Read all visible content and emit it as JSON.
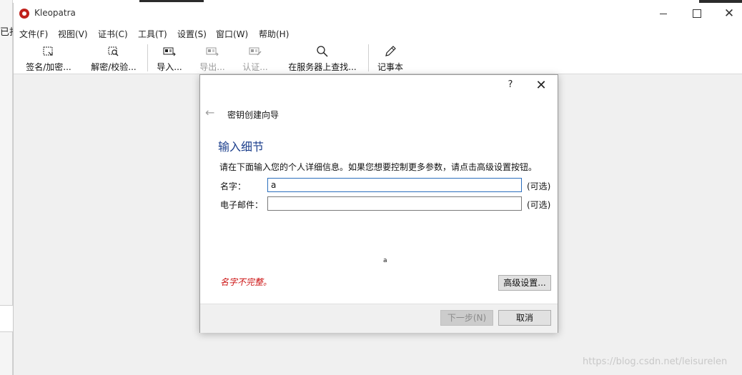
{
  "background": {
    "left_fragment": "已打"
  },
  "window": {
    "title": "Kleopatra",
    "minimize_glyph": "",
    "maximize_glyph": "",
    "close_glyph": "✕"
  },
  "menu": {
    "items": [
      "文件(F)",
      "视图(V)",
      "证书(C)",
      "工具(T)",
      "设置(S)",
      "窗口(W)",
      "帮助(H)"
    ]
  },
  "toolbar": {
    "items": [
      {
        "label": "签名/加密...",
        "icon": "sign-encrypt-icon",
        "enabled": true
      },
      {
        "label": "解密/校验...",
        "icon": "decrypt-verify-icon",
        "enabled": true
      },
      {
        "label": "导入...",
        "icon": "import-icon",
        "enabled": true
      },
      {
        "label": "导出...",
        "icon": "export-icon",
        "enabled": false
      },
      {
        "label": "认证...",
        "icon": "certify-icon",
        "enabled": false
      },
      {
        "label": "在服务器上查找...",
        "icon": "search-icon",
        "enabled": true
      },
      {
        "label": "记事本",
        "icon": "pencil-icon",
        "enabled": true
      }
    ]
  },
  "dialog": {
    "help_glyph": "?",
    "close_glyph": "✕",
    "back_glyph": "←",
    "wizard_title": "密钥创建向导",
    "heading": "输入细节",
    "description": "请在下面输入您的个人详细信息。如果您想要控制更多参数，请点击高级设置按钮。",
    "fields": [
      {
        "label": "名字：",
        "value": "a",
        "optional": "(可选)"
      },
      {
        "label": "电子邮件：",
        "value": "",
        "optional": "(可选)"
      }
    ],
    "stray_text": "a",
    "error_message": "名字不完整。",
    "advanced_button": "高级设置...",
    "next_button": "下一步(N)",
    "cancel_button": "取消"
  },
  "watermark": "https://blog.csdn.net/leisurelen"
}
